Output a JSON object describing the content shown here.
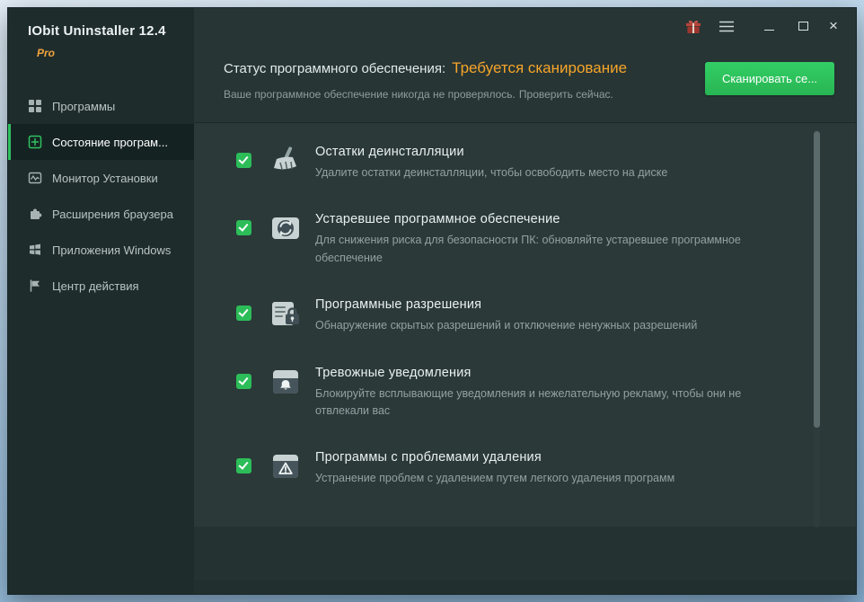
{
  "window": {
    "app_title": "IObit Uninstaller 12.4",
    "edition": "Pro"
  },
  "titlebar": {
    "close_glyph": "×"
  },
  "sidebar": {
    "items": [
      {
        "label": "Программы",
        "icon": "apps-grid-icon",
        "active": false
      },
      {
        "label": "Состояние програм...",
        "icon": "health-plus-icon",
        "active": true
      },
      {
        "label": "Монитор Установки",
        "icon": "install-monitor-icon",
        "active": false
      },
      {
        "label": "Расширения браузера",
        "icon": "browser-extensions-puzzle-icon",
        "active": false
      },
      {
        "label": "Приложения Windows",
        "icon": "windows-apps-icon",
        "active": false
      },
      {
        "label": "Центр действия",
        "icon": "action-center-flag-icon",
        "active": false
      }
    ]
  },
  "header": {
    "status_label": "Статус программного обеспечения:",
    "status_value": "Требуется сканирование",
    "subtitle": "Ваше программное обеспечение никогда не проверялось.",
    "check_now_link": "Проверить сейчас.",
    "scan_button_label": "Сканировать се..."
  },
  "scan_list": {
    "items": [
      {
        "checked": true,
        "icon": "uninstall-leftovers-broom-icon",
        "title": "Остатки деинсталляции",
        "description": "Удалите остатки деинсталляции, чтобы освободить место на диске"
      },
      {
        "checked": true,
        "icon": "outdated-software-globe-icon",
        "title": "Устаревшее программное обеспечение",
        "description": "Для снижения риска для безопасности ПК: обновляйте устаревшее программное обеспечение"
      },
      {
        "checked": true,
        "icon": "software-permissions-lock-icon",
        "title": "Программные разрешения",
        "description": "Обнаружение скрытых разрешений и отключение ненужных разрешений"
      },
      {
        "checked": true,
        "icon": "alarming-notifications-bell-icon",
        "title": "Тревожные уведомления",
        "description": "Блокируйте всплывающие уведомления и нежелательную рекламу, чтобы они не отвлекали вас"
      },
      {
        "checked": true,
        "icon": "uninstall-problems-warning-icon",
        "title": "Программы с проблемами удаления",
        "description": "Устранение проблем с удалением путем легкого удаления программ"
      }
    ]
  },
  "colors": {
    "accent_orange": "#f6a52a",
    "accent_green": "#2cbd59",
    "sidebar_bg": "#1f2c2c",
    "main_bg": "#273535"
  }
}
